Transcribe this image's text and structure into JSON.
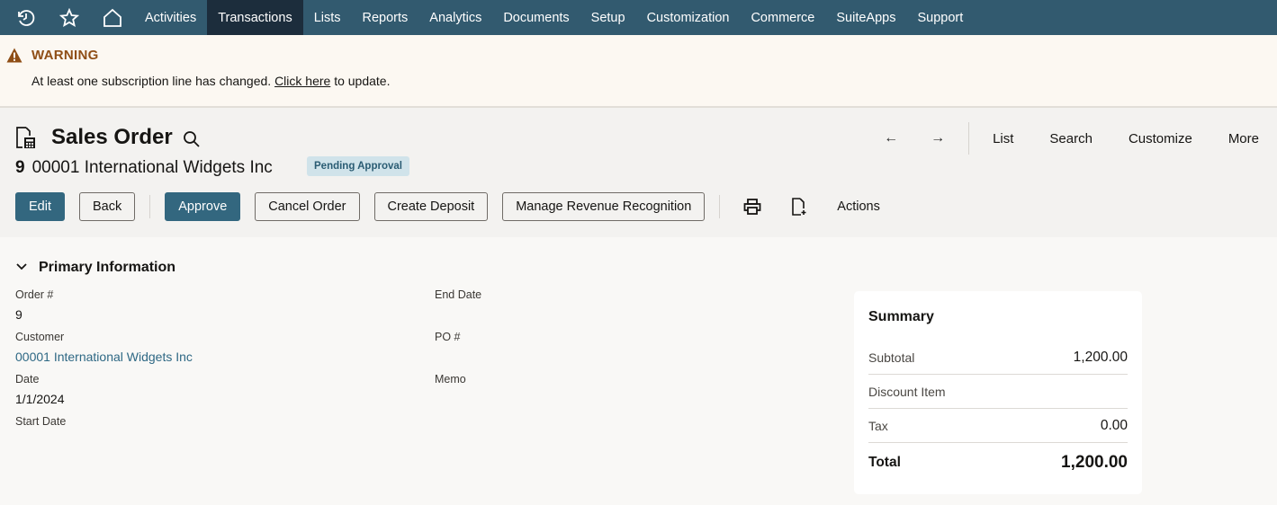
{
  "nav": {
    "icons": [
      "history-icon",
      "favorites-star-icon",
      "home-icon"
    ],
    "items": [
      {
        "label": "Activities",
        "active": false
      },
      {
        "label": "Transactions",
        "active": true
      },
      {
        "label": "Lists",
        "active": false
      },
      {
        "label": "Reports",
        "active": false
      },
      {
        "label": "Analytics",
        "active": false
      },
      {
        "label": "Documents",
        "active": false
      },
      {
        "label": "Setup",
        "active": false
      },
      {
        "label": "Customization",
        "active": false
      },
      {
        "label": "Commerce",
        "active": false
      },
      {
        "label": "SuiteApps",
        "active": false
      },
      {
        "label": "Support",
        "active": false
      }
    ],
    "colors": {
      "bar": "#325a6f",
      "active": "#1c2d3c"
    }
  },
  "warning": {
    "title": "WARNING",
    "message_before": "At least one subscription line has changed.",
    "link": "Click here",
    "message_after": "to update.",
    "color": "#8f4e16"
  },
  "header": {
    "title": "Sales Order",
    "record_number": "9",
    "record_name": "00001 International Widgets Inc",
    "status": "Pending Approval",
    "prev_label": "←",
    "next_label": "→",
    "links": [
      "List",
      "Search",
      "Customize",
      "More"
    ]
  },
  "buttons": {
    "edit": "Edit",
    "back": "Back",
    "approve": "Approve",
    "cancel_order": "Cancel Order",
    "create_deposit": "Create Deposit",
    "manage_rev_rec": "Manage Revenue Recognition",
    "actions": "Actions",
    "primary_color": "#33677f"
  },
  "primary_info": {
    "section_title": "Primary Information",
    "left": [
      {
        "label": "Order #",
        "value": "9"
      },
      {
        "label": "Customer",
        "value": "00001 International Widgets Inc"
      },
      {
        "label": "Date",
        "value": "1/1/2024"
      },
      {
        "label": "Start Date",
        "value": ""
      }
    ],
    "right": [
      {
        "label": "End Date",
        "value": ""
      },
      {
        "label": "PO #",
        "value": ""
      },
      {
        "label": "Memo",
        "value": ""
      }
    ]
  },
  "summary": {
    "title": "Summary",
    "rows": [
      {
        "label": "Subtotal",
        "value": "1,200.00"
      },
      {
        "label": "Discount Item",
        "value": ""
      },
      {
        "label": "Tax",
        "value": "0.00"
      },
      {
        "label": "Total",
        "value": "1,200.00"
      }
    ]
  }
}
